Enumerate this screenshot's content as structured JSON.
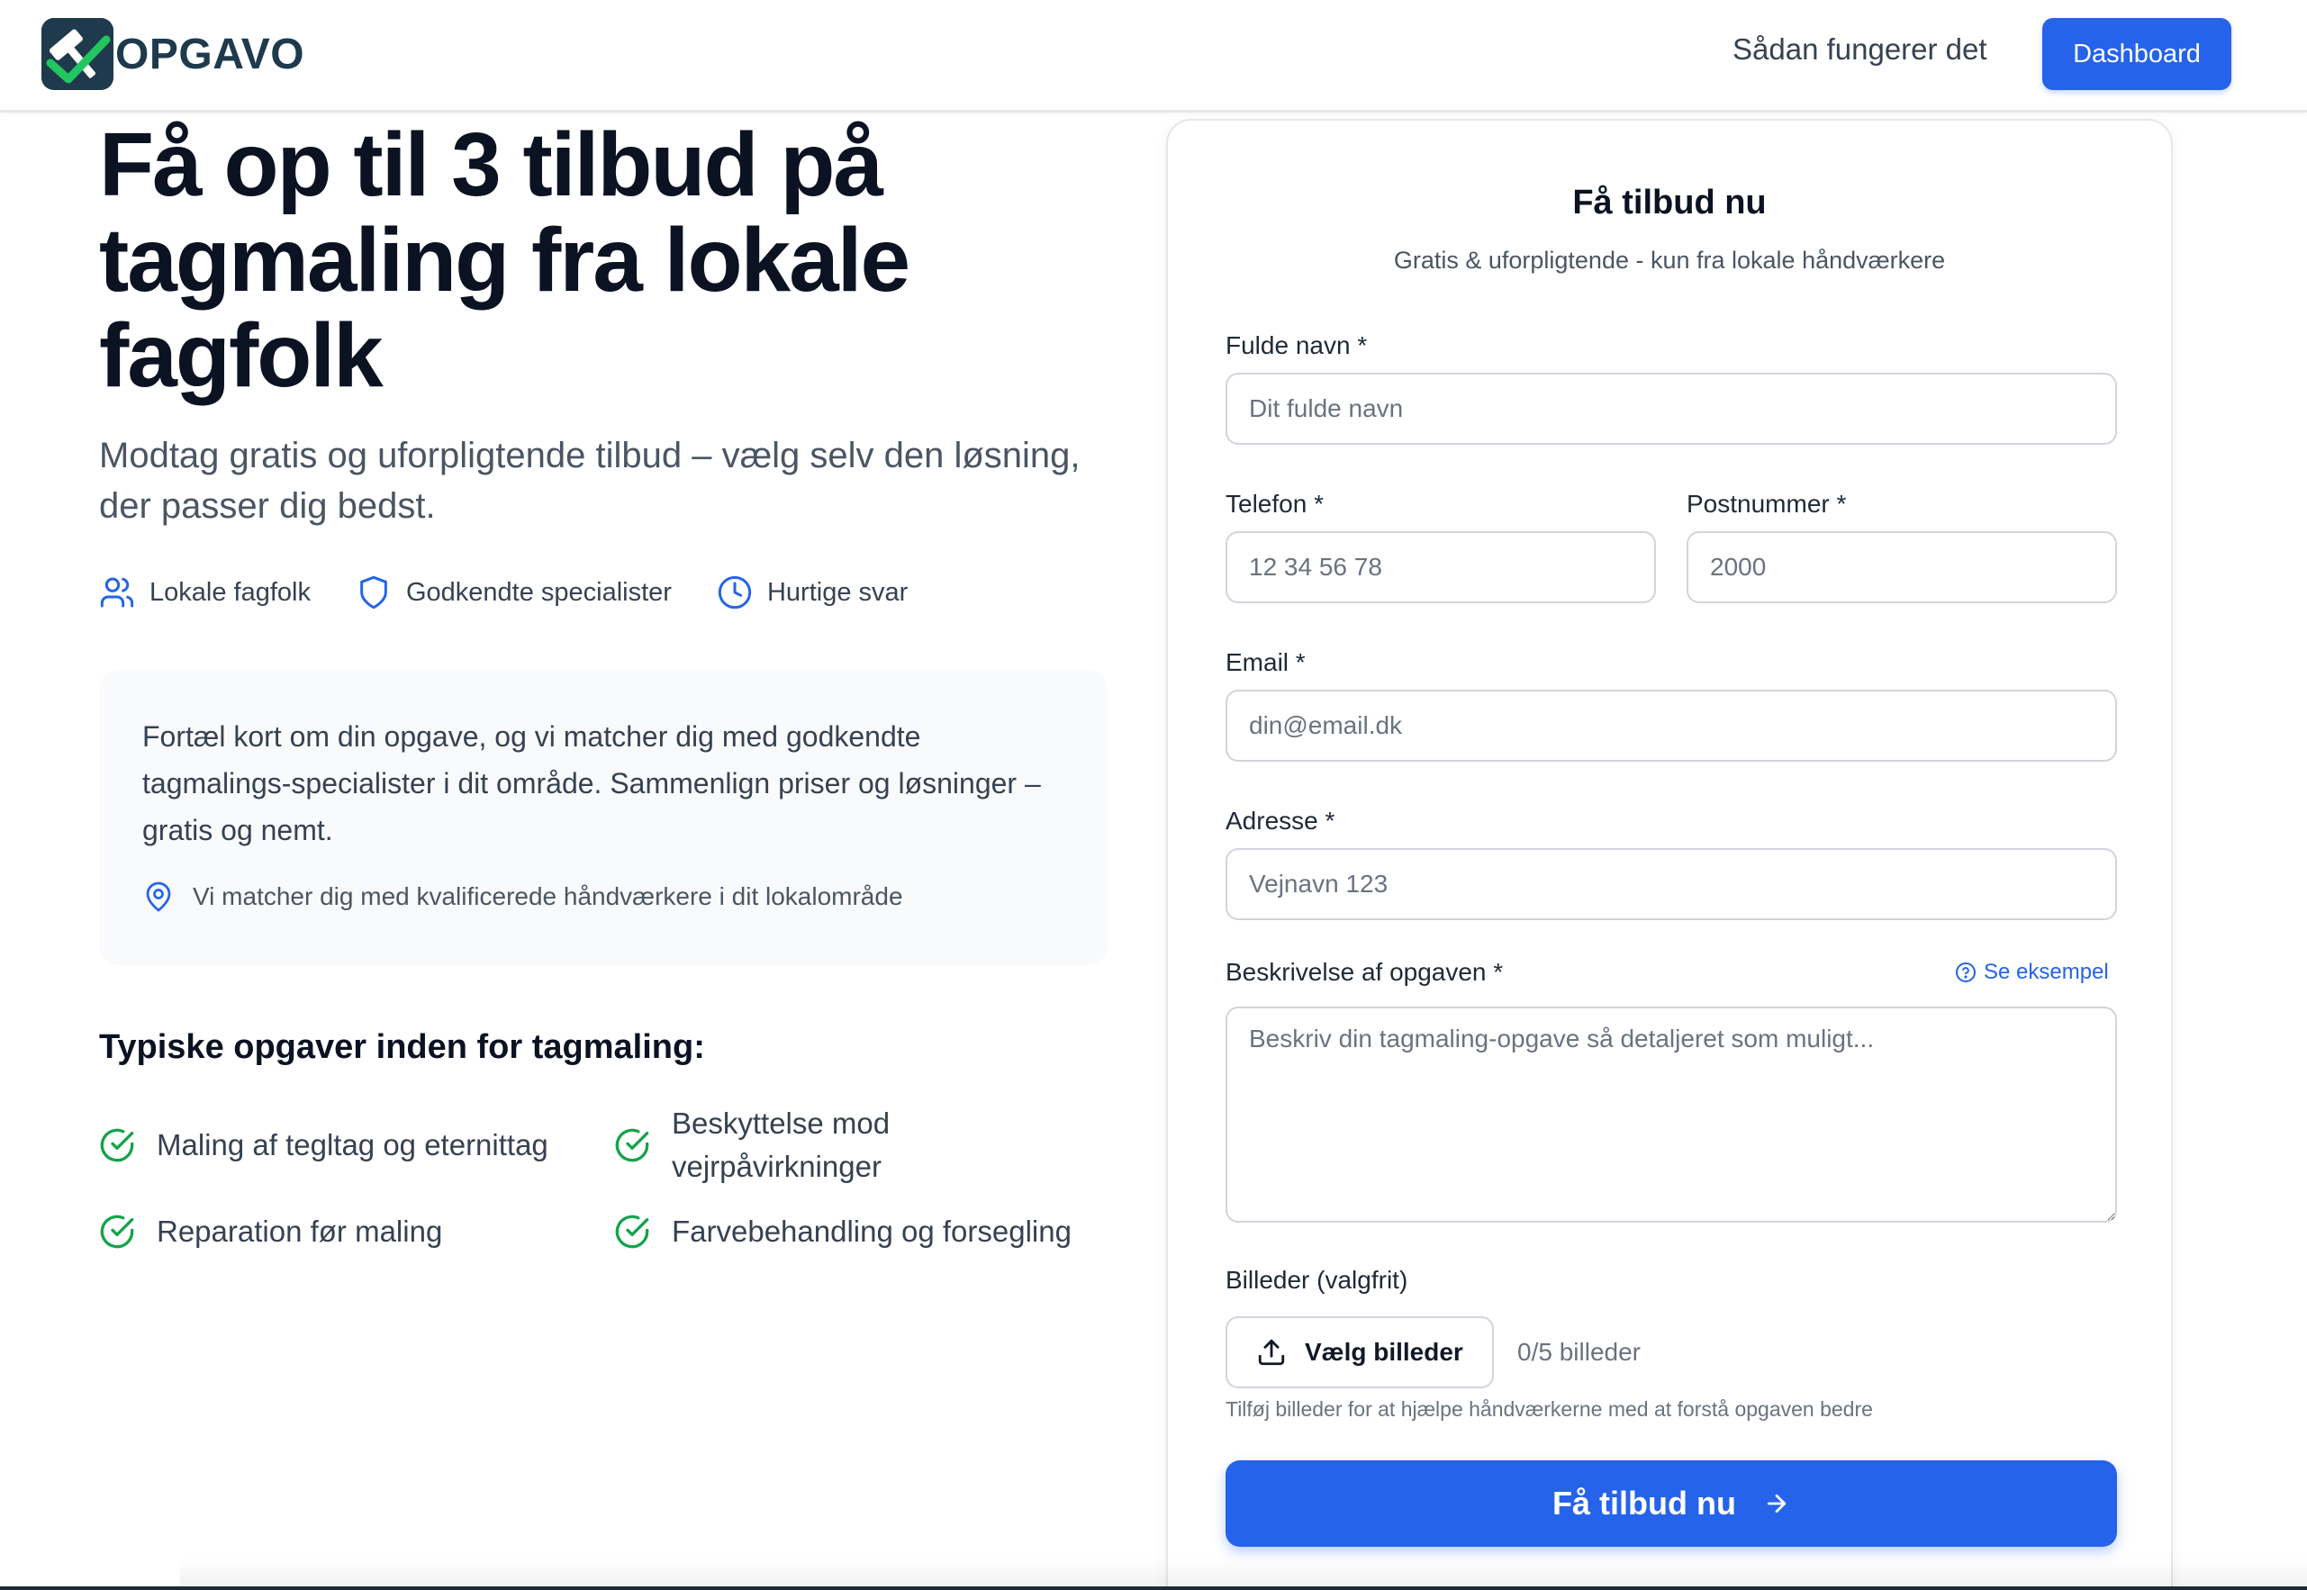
{
  "header": {
    "brand": "OPGAVO",
    "nav_link": "Sådan fungerer det",
    "dashboard_label": "Dashboard"
  },
  "hero": {
    "title": "Få op til 3 tilbud på tagmaling fra lokale fagfolk",
    "subtitle": "Modtag gratis og uforpligtende tilbud – vælg selv den løsning, der passer dig bedst.",
    "features": [
      {
        "icon": "users-icon",
        "label": "Lokale fagfolk"
      },
      {
        "icon": "shield-icon",
        "label": "Godkendte specialister"
      },
      {
        "icon": "clock-icon",
        "label": "Hurtige svar"
      }
    ]
  },
  "info": {
    "text": "Fortæl kort om din opgave, og vi matcher dig med godkendte tagmalings-specialister i dit område. Sammenlign priser og løsninger – gratis og nemt.",
    "location_note": "Vi matcher dig med kvalificerede håndværkere i dit lokalområde"
  },
  "tasks": {
    "title": "Typiske opgaver inden for tagmaling:",
    "items": [
      "Maling af tegltag og eternittag",
      "Beskyttelse mod vejrpåvirkninger",
      "Reparation før maling",
      "Farvebehandling og forsegling"
    ]
  },
  "form": {
    "title": "Få tilbud nu",
    "subtitle": "Gratis & uforpligtende - kun fra lokale håndværkere",
    "name_label": "Fulde navn *",
    "name_placeholder": "Dit fulde navn",
    "phone_label": "Telefon *",
    "phone_placeholder": "12 34 56 78",
    "zip_label": "Postnummer *",
    "zip_placeholder": "2000",
    "email_label": "Email *",
    "email_placeholder": "din@email.dk",
    "address_label": "Adresse *",
    "address_placeholder": "Vejnavn 123",
    "desc_label": "Beskrivelse af opgaven *",
    "example_link": "Se eksempel",
    "desc_placeholder": "Beskriv din tagmaling-opgave så detaljeret som muligt...",
    "images_label": "Billeder (valgfrit)",
    "upload_label": "Vælg billeder",
    "image_count": "0/5 billeder",
    "images_help": "Tilføj billeder for at hjælpe håndværkerne med at forstå opgaven bedre",
    "submit_label": "Få tilbud nu"
  },
  "colors": {
    "primary": "#2563eb",
    "success": "#16a34a",
    "brand_dark": "#1e3a4c"
  }
}
